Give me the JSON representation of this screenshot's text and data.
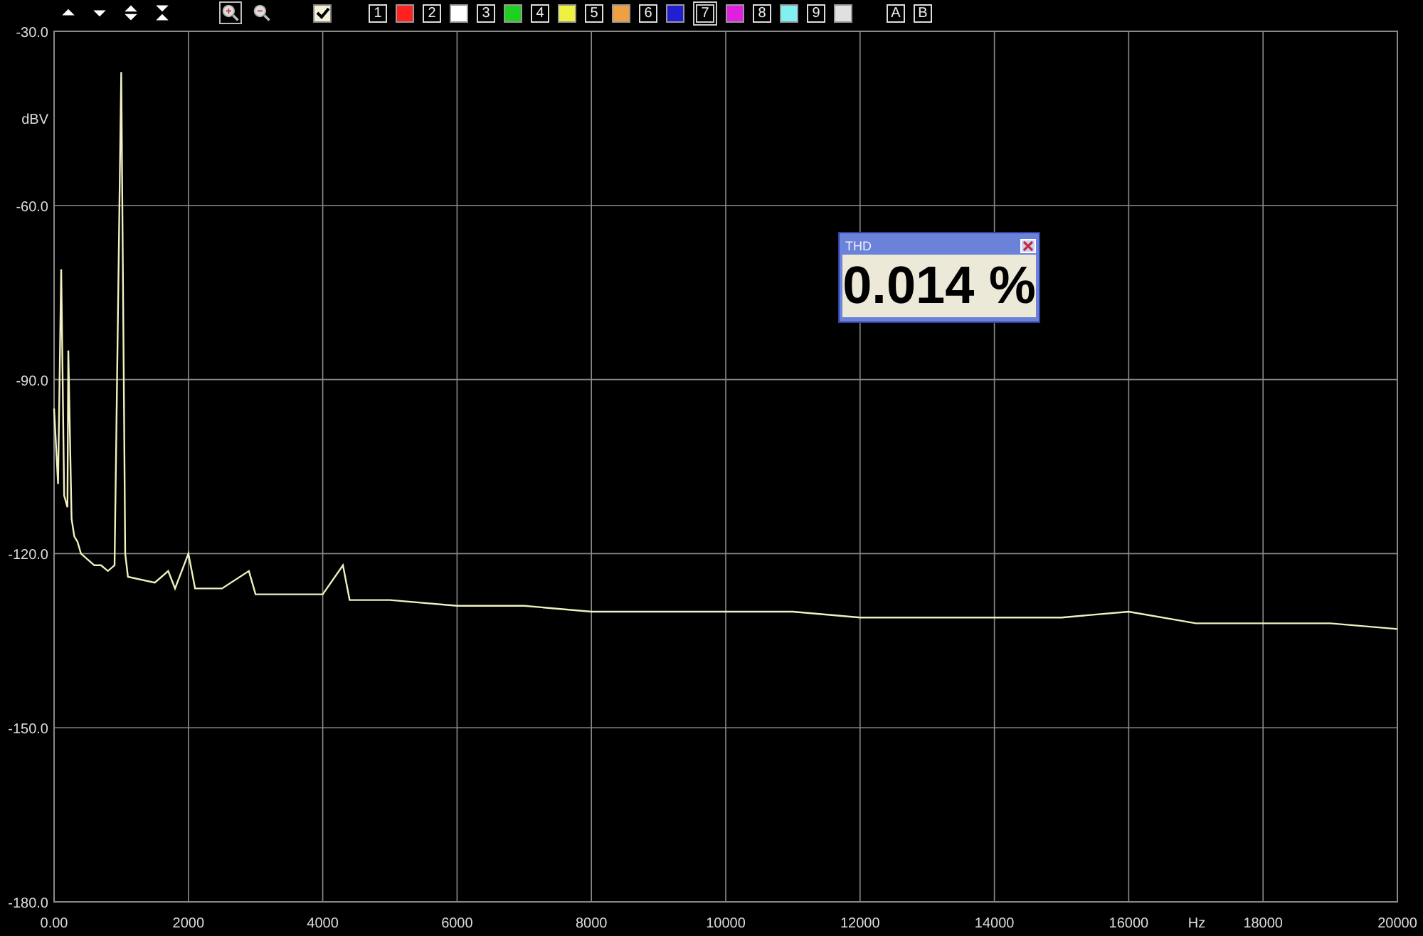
{
  "toolbar": {
    "tools": [
      {
        "kind": "up"
      },
      {
        "kind": "down"
      },
      {
        "kind": "expand"
      },
      {
        "kind": "shrink"
      },
      {
        "kind": "zoom-in",
        "selected": true
      },
      {
        "kind": "zoom-out",
        "selected": false
      }
    ],
    "check": {
      "checked": true
    },
    "channels": [
      {
        "label": "1",
        "color": "#ff2020",
        "selected": false
      },
      {
        "label": "2",
        "color": "#ffffff",
        "selected": false
      },
      {
        "label": "3",
        "color": "#20d020",
        "selected": false
      },
      {
        "label": "4",
        "color": "#f0f040",
        "selected": false
      },
      {
        "label": "5",
        "color": "#f0a040",
        "selected": false
      },
      {
        "label": "6",
        "color": "#2020d0",
        "selected": false
      },
      {
        "label": "7",
        "color": "#e020e0",
        "selected": true
      },
      {
        "label": "8",
        "color": "#80f0f0",
        "selected": false
      },
      {
        "label": "9",
        "color": "#e0e0e0",
        "selected": false
      }
    ],
    "markers": [
      "A",
      "B"
    ]
  },
  "chart": {
    "chart_data": {
      "type": "line",
      "xlabel": "Hz",
      "ylabel": "dBV",
      "xlim": [
        0,
        20000
      ],
      "ylim": [
        -180,
        -30
      ],
      "xticks": [
        {
          "value": 0,
          "label": "0.00"
        },
        2000,
        4000,
        6000,
        8000,
        10000,
        12000,
        14000,
        16000,
        18000,
        20000
      ],
      "yticks": [
        {
          "value": -180,
          "label": "-180.0"
        },
        {
          "value": -150,
          "label": "-150.0"
        },
        {
          "value": -120,
          "label": "-120.0"
        },
        {
          "value": -90,
          "label": "-90.0"
        },
        {
          "value": -60,
          "label": "-60.0"
        },
        {
          "value": -30,
          "label": "-30.0"
        }
      ],
      "x": [
        0,
        60,
        106,
        150,
        200,
        212,
        260,
        300,
        350,
        400,
        500,
        600,
        700,
        800,
        900,
        1000,
        1060,
        1100,
        1500,
        1700,
        1800,
        2000,
        2100,
        2500,
        2900,
        3000,
        3500,
        4000,
        4300,
        4400,
        5000,
        6000,
        7000,
        8000,
        9000,
        10000,
        11000,
        12000,
        13000,
        14000,
        15000,
        16000,
        17000,
        18000,
        19000,
        20000
      ],
      "grid": true,
      "series": [
        {
          "color": "#f0f0c0",
          "values": [
            -95,
            -108,
            -71,
            -110,
            -112,
            -85,
            -114,
            -117,
            -118,
            -120,
            -121,
            -122,
            -122,
            -123,
            -122,
            -37,
            -120,
            -124,
            -125,
            -123,
            -126,
            -120,
            -126,
            -126,
            -123,
            -127,
            -127,
            -127,
            -122,
            -128,
            -128,
            -129,
            -129,
            -130,
            -130,
            -130,
            -130,
            -131,
            -131,
            -131,
            -131,
            -130,
            -132,
            -132,
            -132,
            -133
          ]
        }
      ]
    }
  },
  "thd": {
    "title": "THD",
    "value": "0.014 %"
  }
}
